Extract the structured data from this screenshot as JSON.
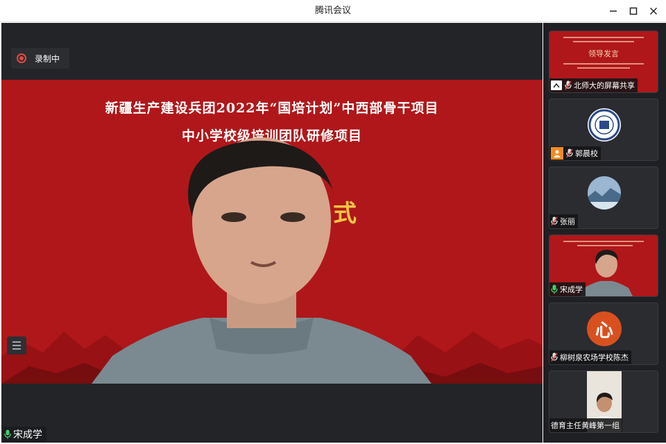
{
  "window": {
    "title": "腾讯会议"
  },
  "recording": {
    "label": "录制中"
  },
  "shared_slide": {
    "line1": "新疆生产建设兵团2022年“国培计划”中西部骨干项目",
    "line2": "中小学校级培训团队研修项目",
    "partial_char": "式"
  },
  "main_speaker": {
    "name": "宋成学"
  },
  "participants": [
    {
      "name": "北师大的屏幕共享",
      "slide_title": "领导发言"
    },
    {
      "name": "郭晨校"
    },
    {
      "name": "张丽"
    },
    {
      "name": "宋成学"
    },
    {
      "name": "柳树泉农场学校陈杰",
      "avatar_char": "心"
    },
    {
      "name": "德育主任黄峰第一组"
    }
  ],
  "colors": {
    "accent_red": "#b0171a",
    "record_red": "#e5483f",
    "mic_green": "#3ecf6a"
  }
}
